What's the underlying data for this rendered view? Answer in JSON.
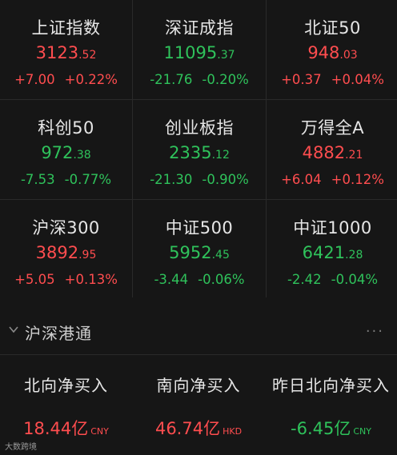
{
  "indices": [
    {
      "name": "上证指数",
      "int": "3123",
      "dec": ".52",
      "chg": "+7.00",
      "pct": "+0.22%",
      "dir": "up"
    },
    {
      "name": "深证成指",
      "int": "11095",
      "dec": ".37",
      "chg": "-21.76",
      "pct": "-0.20%",
      "dir": "down"
    },
    {
      "name": "北证50",
      "int": "948",
      "dec": ".03",
      "chg": "+0.37",
      "pct": "+0.04%",
      "dir": "up"
    },
    {
      "name": "科创50",
      "int": "972",
      "dec": ".38",
      "chg": "-7.53",
      "pct": "-0.77%",
      "dir": "down"
    },
    {
      "name": "创业板指",
      "int": "2335",
      "dec": ".12",
      "chg": "-21.30",
      "pct": "-0.90%",
      "dir": "down"
    },
    {
      "name": "万得全A",
      "int": "4882",
      "dec": ".21",
      "chg": "+6.04",
      "pct": "+0.12%",
      "dir": "up"
    },
    {
      "name": "沪深300",
      "int": "3892",
      "dec": ".95",
      "chg": "+5.05",
      "pct": "+0.13%",
      "dir": "up"
    },
    {
      "name": "中证500",
      "int": "5952",
      "dec": ".45",
      "chg": "-3.44",
      "pct": "-0.06%",
      "dir": "down"
    },
    {
      "name": "中证1000",
      "int": "6421",
      "dec": ".28",
      "chg": "-2.42",
      "pct": "-0.04%",
      "dir": "down"
    }
  ],
  "section": {
    "title": "沪深港通",
    "more": "···",
    "chevron_icon": "chevron-down-icon"
  },
  "flows": [
    {
      "label": "北向净买入",
      "value": "18.44亿",
      "unit": "CNY",
      "dir": "up"
    },
    {
      "label": "南向净买入",
      "value": "46.74亿",
      "unit": "HKD",
      "dir": "up"
    },
    {
      "label": "昨日北向净买入",
      "value": "-6.45亿",
      "unit": "CNY",
      "dir": "down"
    }
  ],
  "watermark": "大数跨境",
  "colors": {
    "up": "#ff4d4f",
    "down": "#2fc25b",
    "background": "#161616"
  }
}
